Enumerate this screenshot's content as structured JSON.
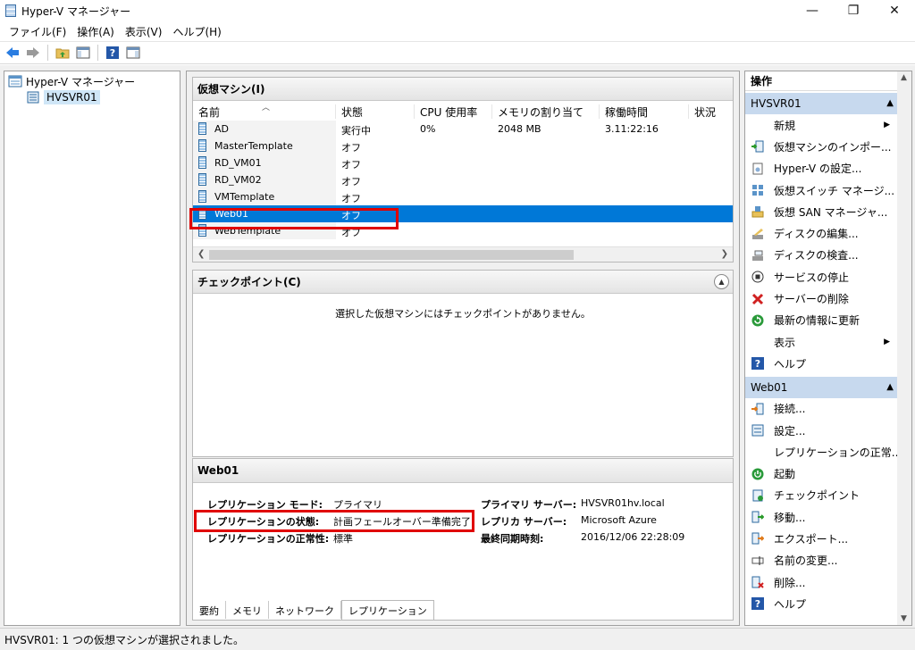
{
  "window": {
    "title": "Hyper-V マネージャー",
    "minimize": "—",
    "maximize": "❐",
    "close": "✕"
  },
  "menu": [
    "ファイル(F)",
    "操作(A)",
    "表示(V)",
    "ヘルプ(H)"
  ],
  "tree": {
    "root": "Hyper-V マネージャー",
    "server": "HVSVR01"
  },
  "vm_pane": {
    "title": "仮想マシン(I)",
    "columns": [
      "名前",
      "状態",
      "CPU 使用率",
      "メモリの割り当て",
      "稼働時間",
      "状況"
    ],
    "rows": [
      {
        "name": "AD",
        "state": "実行中",
        "cpu": "0%",
        "mem": "2048 MB",
        "uptime": "3.11:22:16"
      },
      {
        "name": "MasterTemplate",
        "state": "オフ",
        "cpu": "",
        "mem": "",
        "uptime": ""
      },
      {
        "name": "RD_VM01",
        "state": "オフ",
        "cpu": "",
        "mem": "",
        "uptime": ""
      },
      {
        "name": "RD_VM02",
        "state": "オフ",
        "cpu": "",
        "mem": "",
        "uptime": ""
      },
      {
        "name": "VMTemplate",
        "state": "オフ",
        "cpu": "",
        "mem": "",
        "uptime": ""
      },
      {
        "name": "Web01",
        "state": "オフ",
        "cpu": "",
        "mem": "",
        "uptime": ""
      },
      {
        "name": "WebTemplate",
        "state": "オフ",
        "cpu": "",
        "mem": "",
        "uptime": ""
      }
    ],
    "selected_index": 5
  },
  "checkpoint_pane": {
    "title": "チェックポイント(C)",
    "empty_message": "選択した仮想マシンにはチェックポイントがありません。"
  },
  "details_pane": {
    "title": "Web01",
    "left": [
      {
        "label": "レプリケーション モード:",
        "value": "プライマリ"
      },
      {
        "label": "レプリケーションの状態:",
        "value": "計画フェールオーバー準備完了"
      },
      {
        "label": "レプリケーションの正常性:",
        "value": "標準"
      }
    ],
    "right": [
      {
        "label": "プライマリ サーバー:",
        "value": "HVSVR01hv.local"
      },
      {
        "label": "レプリカ サーバー:",
        "value": "Microsoft Azure"
      },
      {
        "label": "最終同期時刻:",
        "value": "2016/12/06 22:28:09"
      }
    ],
    "tabs": [
      "要約",
      "メモリ",
      "ネットワーク",
      "レプリケーション"
    ],
    "active_tab": 3
  },
  "actions": {
    "title": "操作",
    "server_group": "HVSVR01",
    "server_items": [
      {
        "label": "新規",
        "icon": "none",
        "submenu": true
      },
      {
        "label": "仮想マシンのインポー...",
        "icon": "import-icon"
      },
      {
        "label": "Hyper-V の設定...",
        "icon": "settings-doc-icon"
      },
      {
        "label": "仮想スイッチ マネージ...",
        "icon": "switch-icon"
      },
      {
        "label": "仮想 SAN マネージャ...",
        "icon": "san-icon"
      },
      {
        "label": "ディスクの編集...",
        "icon": "disk-edit-icon"
      },
      {
        "label": "ディスクの検査...",
        "icon": "disk-inspect-icon"
      },
      {
        "label": "サービスの停止",
        "icon": "stop-icon"
      },
      {
        "label": "サーバーの削除",
        "icon": "remove-icon"
      },
      {
        "label": "最新の情報に更新",
        "icon": "refresh-icon"
      },
      {
        "label": "表示",
        "icon": "none",
        "submenu": true
      },
      {
        "label": "ヘルプ",
        "icon": "help-icon"
      }
    ],
    "vm_group": "Web01",
    "vm_items": [
      {
        "label": "接続...",
        "icon": "connect-icon"
      },
      {
        "label": "設定...",
        "icon": "settings-icon"
      },
      {
        "label": "レプリケーションの正常...",
        "icon": "none"
      },
      {
        "label": "起動",
        "icon": "start-icon"
      },
      {
        "label": "チェックポイント",
        "icon": "checkpoint-icon"
      },
      {
        "label": "移動...",
        "icon": "move-icon"
      },
      {
        "label": "エクスポート...",
        "icon": "export-icon"
      },
      {
        "label": "名前の変更...",
        "icon": "rename-icon"
      },
      {
        "label": "削除...",
        "icon": "delete-icon"
      },
      {
        "label": "ヘルプ",
        "icon": "help-icon"
      }
    ]
  },
  "status": "HVSVR01: 1 つの仮想マシンが選択されました。",
  "colors": {
    "selection": "#0078d7",
    "highlight_box": "#e00000",
    "group_header": "#c7d9ee"
  }
}
